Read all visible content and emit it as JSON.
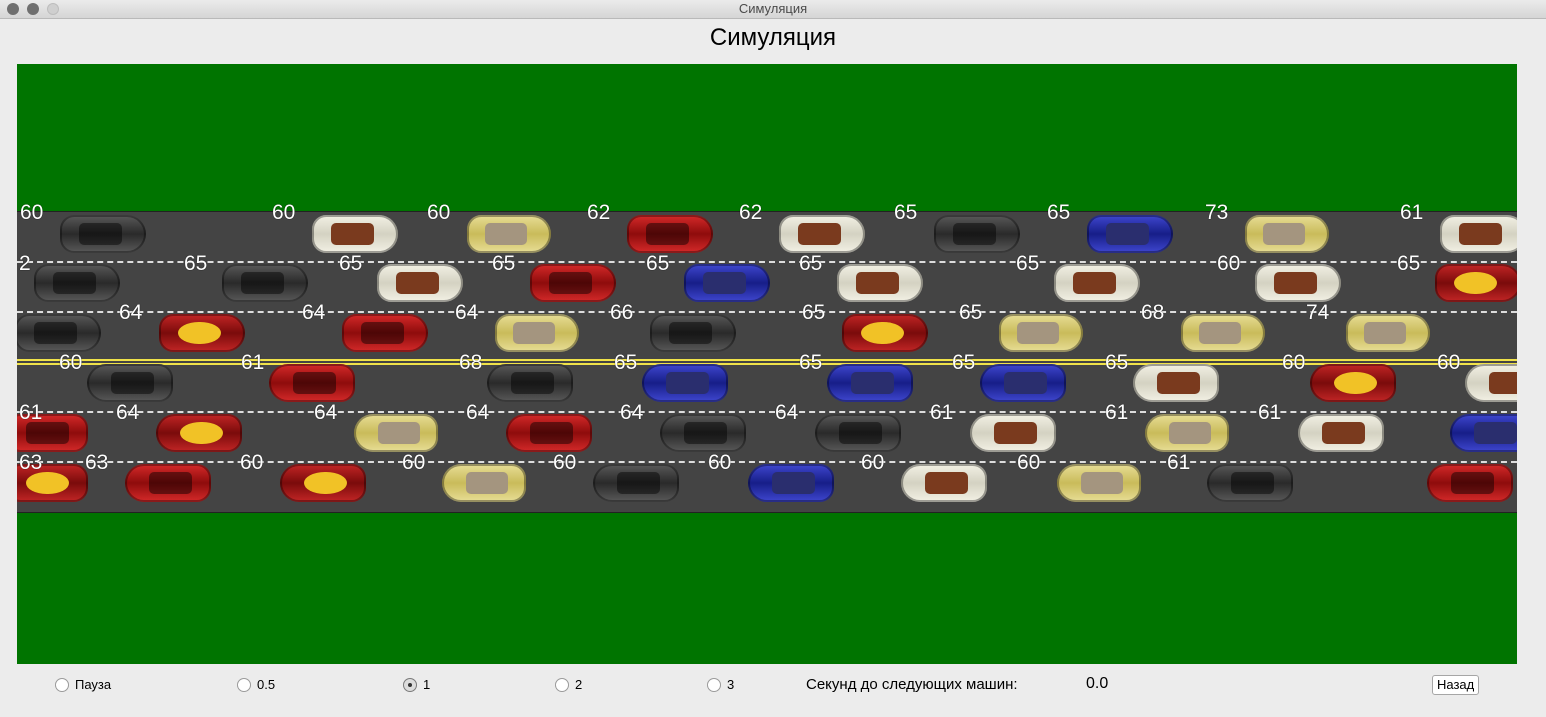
{
  "window": {
    "title": "Симуляция"
  },
  "page": {
    "heading": "Симуляция"
  },
  "scene_colors": {
    "grass": "#007400",
    "road": "#444444",
    "lane_marking": "#dddddd",
    "center_line": "#f0e24a"
  },
  "lanes": [
    {
      "direction": "right",
      "cars": [
        {
          "model": "dark",
          "speed": "60"
        },
        {
          "model": "cream",
          "speed": "60"
        },
        {
          "model": "gold",
          "speed": "60"
        },
        {
          "model": "red",
          "speed": "62"
        },
        {
          "model": "cream",
          "speed": "62"
        },
        {
          "model": "dark",
          "speed": "65"
        },
        {
          "model": "blue",
          "speed": "65"
        },
        {
          "model": "gold",
          "speed": "73"
        },
        {
          "model": "cream",
          "speed": "61"
        }
      ]
    },
    {
      "direction": "right",
      "cars": [
        {
          "model": "dark",
          "speed": "2"
        },
        {
          "model": "dark",
          "speed": "65"
        },
        {
          "model": "cream",
          "speed": "65"
        },
        {
          "model": "red",
          "speed": "65"
        },
        {
          "model": "blue",
          "speed": "65"
        },
        {
          "model": "cream",
          "speed": "65"
        },
        {
          "model": "cream",
          "speed": "65"
        },
        {
          "model": "cream",
          "speed": "60"
        },
        {
          "model": "taxi",
          "speed": "65"
        }
      ]
    },
    {
      "direction": "right",
      "cars": [
        {
          "model": "dark",
          "speed": ""
        },
        {
          "model": "taxi",
          "speed": "64"
        },
        {
          "model": "red",
          "speed": "64"
        },
        {
          "model": "gold",
          "speed": "64"
        },
        {
          "model": "dark",
          "speed": "66"
        },
        {
          "model": "taxi",
          "speed": "65"
        },
        {
          "model": "gold",
          "speed": "65"
        },
        {
          "model": "gold",
          "speed": "68"
        },
        {
          "model": "gold",
          "speed": "74"
        }
      ]
    },
    {
      "direction": "left",
      "cars": [
        {
          "model": "dark",
          "speed": "60"
        },
        {
          "model": "red",
          "speed": "61"
        },
        {
          "model": "dark",
          "speed": "68"
        },
        {
          "model": "blue",
          "speed": "65"
        },
        {
          "model": "blue",
          "speed": "65"
        },
        {
          "model": "blue",
          "speed": "65"
        },
        {
          "model": "cream",
          "speed": "65"
        },
        {
          "model": "taxi",
          "speed": "60"
        },
        {
          "model": "cream",
          "speed": "60"
        }
      ]
    },
    {
      "direction": "left",
      "cars": [
        {
          "model": "red",
          "speed": "61"
        },
        {
          "model": "taxi",
          "speed": "64"
        },
        {
          "model": "gold",
          "speed": "64"
        },
        {
          "model": "red",
          "speed": "64"
        },
        {
          "model": "dark",
          "speed": "64"
        },
        {
          "model": "dark",
          "speed": "64"
        },
        {
          "model": "cream",
          "speed": "61"
        },
        {
          "model": "gold",
          "speed": "61"
        },
        {
          "model": "cream",
          "speed": "61"
        },
        {
          "model": "blue",
          "speed": ""
        }
      ]
    },
    {
      "direction": "left",
      "cars": [
        {
          "model": "taxi",
          "speed": "63"
        },
        {
          "model": "red",
          "speed": "63"
        },
        {
          "model": "taxi",
          "speed": "60"
        },
        {
          "model": "gold",
          "speed": "60"
        },
        {
          "model": "dark",
          "speed": "60"
        },
        {
          "model": "blue",
          "speed": "60"
        },
        {
          "model": "cream",
          "speed": "60"
        },
        {
          "model": "gold",
          "speed": "60"
        },
        {
          "model": "dark",
          "speed": "61"
        },
        {
          "model": "red",
          "speed": ""
        }
      ]
    }
  ],
  "controls": {
    "speed_options": [
      {
        "label": "Пауза",
        "checked": false
      },
      {
        "label": "0.5",
        "checked": false
      },
      {
        "label": "1",
        "checked": true
      },
      {
        "label": "2",
        "checked": false
      },
      {
        "label": "3",
        "checked": false
      }
    ],
    "next_cars_label": "Секунд до следующих машин:",
    "next_cars_value": "0.0",
    "back_button": "Назад"
  }
}
